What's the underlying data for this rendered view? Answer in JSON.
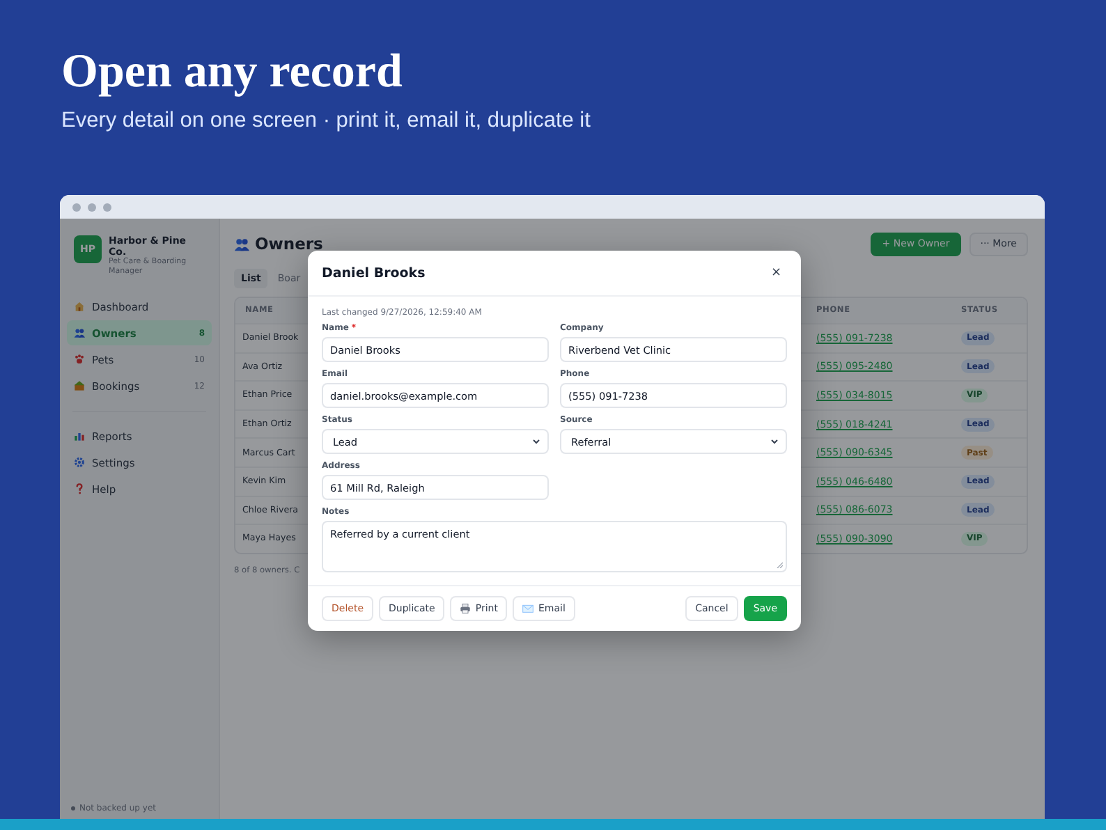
{
  "hero": {
    "title": "Open any record",
    "subtitle": "Every detail on one screen · print it, email it, duplicate it"
  },
  "app": {
    "brand": {
      "initials": "HP",
      "name": "Harbor & Pine Co.",
      "tagline": "Pet Care & Boarding Manager"
    },
    "nav": [
      {
        "label": "Dashboard",
        "selected": false
      },
      {
        "label": "Owners",
        "count": "8",
        "selected": true
      },
      {
        "label": "Pets",
        "count": "10",
        "selected": false
      },
      {
        "label": "Bookings",
        "count": "12",
        "selected": false
      }
    ],
    "nav_secondary": [
      {
        "label": "Reports",
        "selected": false
      },
      {
        "label": "Settings",
        "selected": false
      },
      {
        "label": "Help",
        "selected": false
      }
    ],
    "backup_status": "Not backed up yet",
    "page": {
      "title": "Owners",
      "actions": [
        {
          "label": "+ New Owner",
          "kind": "primary"
        },
        {
          "label": "··· More",
          "kind": "secondary"
        }
      ],
      "view_tabs": [
        {
          "label": "List",
          "selected": true
        },
        {
          "label": "Boar",
          "selected": false
        }
      ],
      "table": {
        "columns": [
          "NAME",
          "PHONE",
          "STATUS"
        ],
        "rows": [
          {
            "name": "Daniel Brook",
            "phone": "(555) 091-7238",
            "status": "Lead",
            "kind": "lead"
          },
          {
            "name": "Ava Ortiz",
            "phone": "(555) 095-2480",
            "status": "Lead",
            "kind": "lead"
          },
          {
            "name": "Ethan Price",
            "phone": "(555) 034-8015",
            "status": "VIP",
            "kind": "vip"
          },
          {
            "name": "Ethan Ortiz",
            "phone": "(555) 018-4241",
            "status": "Lead",
            "kind": "lead"
          },
          {
            "name": "Marcus Cart",
            "phone": "(555) 090-6345",
            "status": "Past",
            "kind": "past"
          },
          {
            "name": "Kevin Kim",
            "phone": "(555) 046-6480",
            "status": "Lead",
            "kind": "lead"
          },
          {
            "name": "Chloe Rivera",
            "phone": "(555) 086-6073",
            "status": "Lead",
            "kind": "lead"
          },
          {
            "name": "Maya Hayes",
            "phone": "(555) 090-3090",
            "status": "VIP",
            "kind": "vip"
          }
        ]
      },
      "footer": "8 of 8 owners. C"
    },
    "dialog": {
      "title": "Daniel Brooks",
      "close": "×",
      "meta": "Last changed 9/27/2026, 12:59:40 AM",
      "fields": [
        {
          "label": "Name",
          "required_mark": "*",
          "kind": "text",
          "value": "Daniel Brooks"
        },
        {
          "label": "Company",
          "kind": "text",
          "value": "Riverbend Vet Clinic"
        },
        {
          "label": "Email",
          "kind": "text",
          "value": "daniel.brooks@example.com"
        },
        {
          "label": "Phone",
          "kind": "text",
          "value": "(555) 091-7238"
        },
        {
          "label": "Status",
          "kind": "select",
          "value": "Lead"
        },
        {
          "label": "Source",
          "kind": "select",
          "value": "Referral"
        },
        {
          "label": "Address",
          "kind": "text",
          "value": "61 Mill Rd, Raleigh"
        },
        {
          "label": "Notes",
          "kind": "textarea",
          "value": "Referred by a current client"
        }
      ],
      "left_buttons": [
        {
          "label": "Delete",
          "kind": "danger"
        },
        {
          "label": "Duplicate",
          "kind": "default"
        },
        {
          "label": "Print",
          "kind": "print"
        },
        {
          "label": "Email",
          "kind": "email"
        }
      ],
      "right_buttons": [
        {
          "label": "Cancel",
          "kind": "default"
        },
        {
          "label": "Save",
          "kind": "primary"
        }
      ]
    }
  }
}
